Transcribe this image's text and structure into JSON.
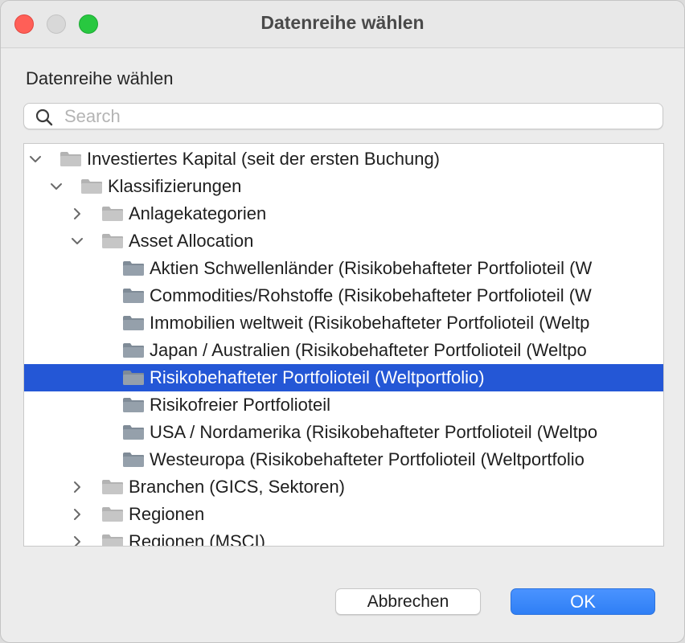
{
  "window": {
    "title": "Datenreihe wählen"
  },
  "dialog": {
    "heading": "Datenreihe wählen",
    "search": {
      "placeholder": "Search",
      "value": ""
    },
    "tree": [
      {
        "label": "Investiertes Kapital (seit der ersten Buchung)",
        "level": 0,
        "state": "expanded"
      },
      {
        "label": "Klassifizierungen",
        "level": 1,
        "state": "expanded"
      },
      {
        "label": "Anlagekategorien",
        "level": 2,
        "state": "collapsed"
      },
      {
        "label": "Asset Allocation",
        "level": 2,
        "state": "expanded"
      },
      {
        "label": "Aktien Schwellenländer (Risikobehafteter Portfolioteil (W",
        "level": 3,
        "state": "leaf"
      },
      {
        "label": "Commodities/Rohstoffe (Risikobehafteter Portfolioteil (W",
        "level": 3,
        "state": "leaf"
      },
      {
        "label": "Immobilien weltweit (Risikobehafteter Portfolioteil (Weltp",
        "level": 3,
        "state": "leaf"
      },
      {
        "label": "Japan / Australien (Risikobehafteter Portfolioteil (Weltpo",
        "level": 3,
        "state": "leaf"
      },
      {
        "label": "Risikobehafteter Portfolioteil (Weltportfolio)",
        "level": 3,
        "state": "leaf",
        "selected": true
      },
      {
        "label": "Risikofreier Portfolioteil",
        "level": 3,
        "state": "leaf"
      },
      {
        "label": "USA / Nordamerika (Risikobehafteter Portfolioteil (Weltpo",
        "level": 3,
        "state": "leaf"
      },
      {
        "label": "Westeuropa (Risikobehafteter Portfolioteil (Weltportfolio",
        "level": 3,
        "state": "leaf"
      },
      {
        "label": "Branchen (GICS, Sektoren)",
        "level": 2,
        "state": "collapsed"
      },
      {
        "label": "Regionen",
        "level": 2,
        "state": "collapsed"
      },
      {
        "label": "Regionen (MSCI)",
        "level": 2,
        "state": "collapsed"
      }
    ],
    "buttons": {
      "cancel": "Abbrechen",
      "ok": "OK"
    }
  },
  "colors": {
    "selection": "#2457d6",
    "ok_button": "#3a87fb",
    "folder": "#c6c6c6",
    "folder_dark": "#95a0ab",
    "close": "#ff5f57",
    "minimize": "#d8d8d8",
    "maximize": "#28c840"
  },
  "icons": {
    "search": "magnifier-icon",
    "expanded": "chevron-down-icon",
    "collapsed": "chevron-right-icon",
    "folder": "folder-icon"
  }
}
